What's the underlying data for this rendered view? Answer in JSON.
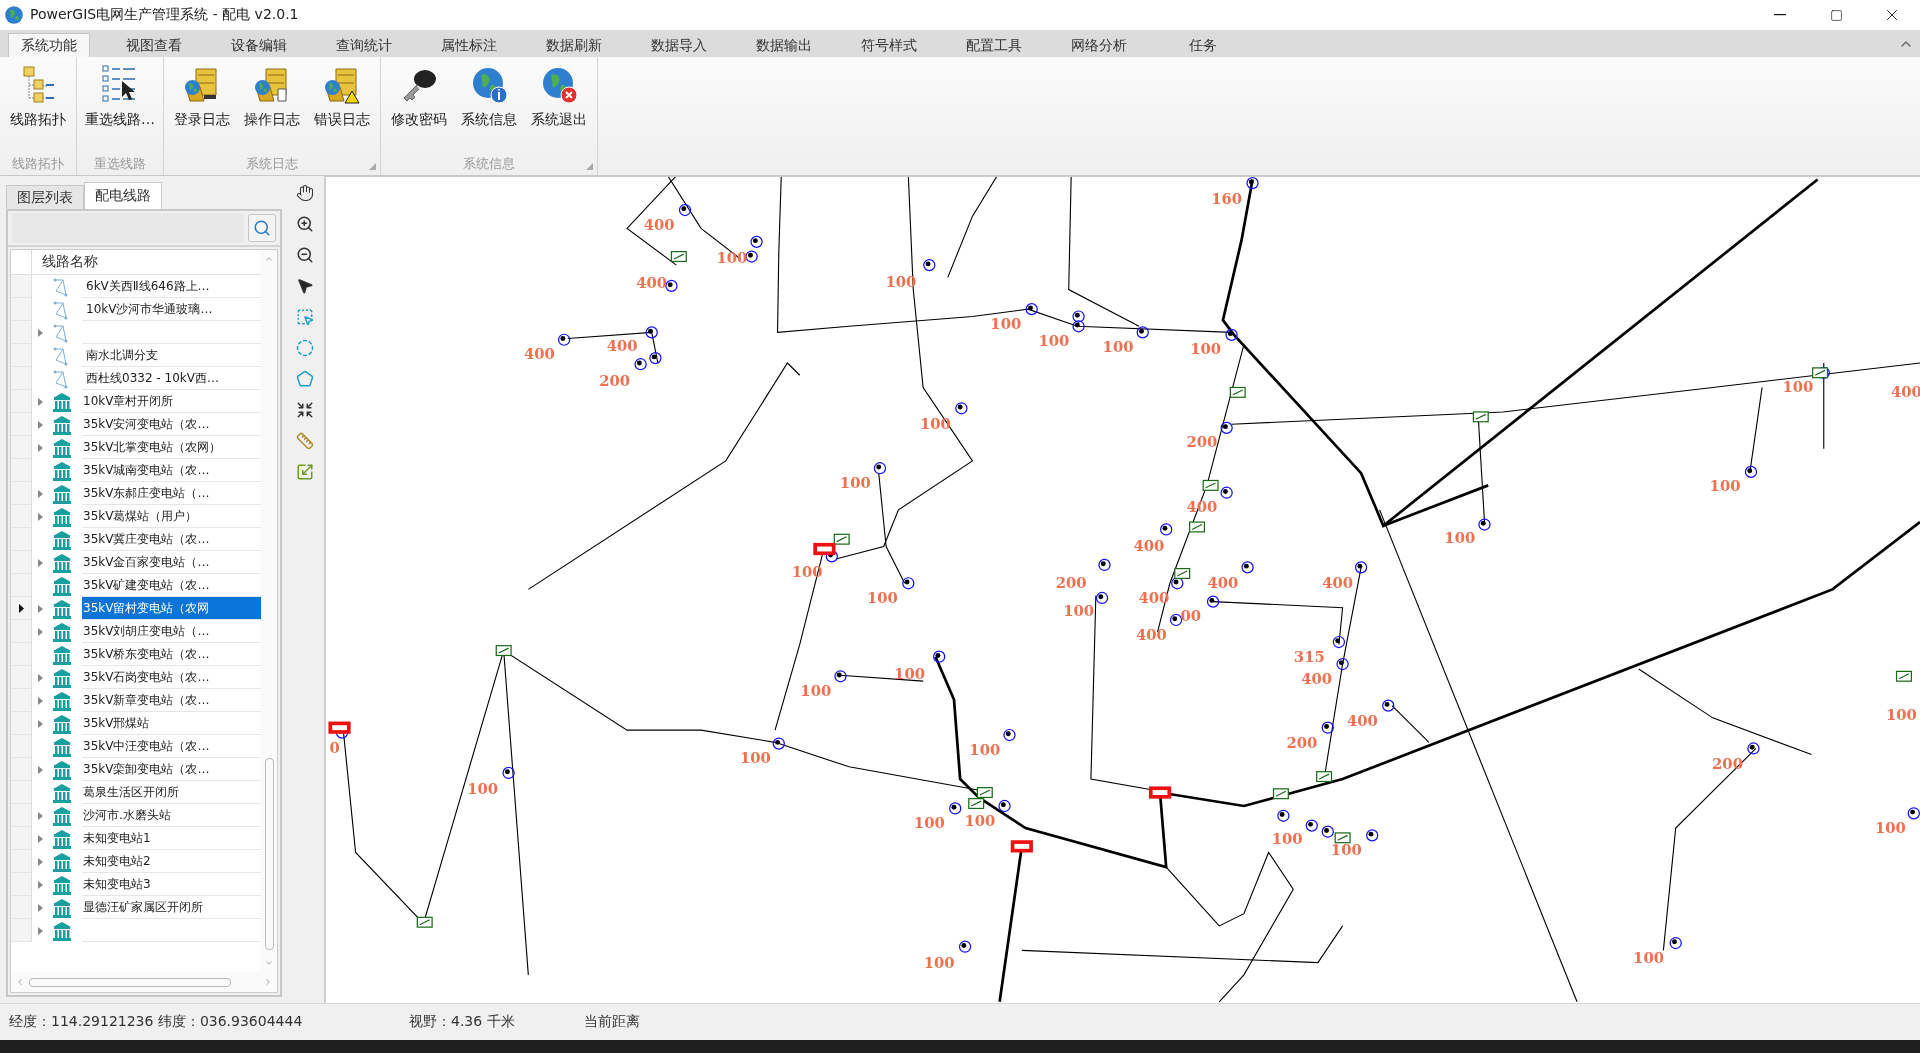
{
  "window": {
    "title": "PowerGIS电网生产管理系统 - 配电 v2.0.1"
  },
  "ribbon_tabs": [
    {
      "label": "系统功能",
      "selected": true
    },
    {
      "label": "视图查看",
      "selected": false
    },
    {
      "label": "设备编辑",
      "selected": false
    },
    {
      "label": "查询统计",
      "selected": false
    },
    {
      "label": "属性标注",
      "selected": false
    },
    {
      "label": "数据刷新",
      "selected": false
    },
    {
      "label": "数据导入",
      "selected": false
    },
    {
      "label": "数据输出",
      "selected": false
    },
    {
      "label": "符号样式",
      "selected": false
    },
    {
      "label": "配置工具",
      "selected": false
    },
    {
      "label": "网络分析",
      "selected": false
    },
    {
      "label": "任务",
      "selected": false
    }
  ],
  "ribbon_groups": [
    {
      "title": "线路拓扑",
      "launcher": false,
      "buttons": [
        {
          "label": "线路拓扑",
          "kind": "topology"
        }
      ]
    },
    {
      "title": "重选线路",
      "launcher": false,
      "buttons": [
        {
          "label": "重选线路…",
          "kind": "reselect"
        }
      ]
    },
    {
      "title": "系统日志",
      "launcher": true,
      "buttons": [
        {
          "label": "登录日志",
          "kind": "log-login"
        },
        {
          "label": "操作日志",
          "kind": "log-operation"
        },
        {
          "label": "错误日志",
          "kind": "log-error"
        }
      ]
    },
    {
      "title": "系统信息",
      "launcher": true,
      "buttons": [
        {
          "label": "修改密码",
          "kind": "key"
        },
        {
          "label": "系统信息",
          "kind": "globe-info"
        },
        {
          "label": "系统退出",
          "kind": "globe-exit"
        }
      ]
    }
  ],
  "left_panel": {
    "tabs": [
      {
        "label": "图层列表",
        "selected": false
      },
      {
        "label": "配电线路",
        "selected": true
      }
    ],
    "column": "线路名称",
    "rows": [
      {
        "kind": "line",
        "label": "6kV关西Ⅱ线646路上…",
        "has_children": false,
        "selected": false
      },
      {
        "kind": "line",
        "label": "10kV沙河市华通玻璃…",
        "has_children": false,
        "selected": false
      },
      {
        "kind": "line",
        "has_children": true,
        "selected": false
      },
      {
        "kind": "line",
        "label": "南水北调分支",
        "has_children": false,
        "selected": false
      },
      {
        "kind": "line",
        "label": "西杜线0332 - 10kV西…",
        "has_children": false,
        "selected": false
      },
      {
        "kind": "station",
        "label": "10kV章村开闭所",
        "has_children": true,
        "selected": false
      },
      {
        "kind": "station",
        "label": "35kV安河变电站（农…",
        "has_children": true,
        "selected": false
      },
      {
        "kind": "station",
        "label": "35kV北掌变电站（农网）",
        "has_children": true,
        "selected": false
      },
      {
        "kind": "station",
        "label": "35kV城南变电站（农…",
        "has_children": false,
        "selected": false
      },
      {
        "kind": "station",
        "label": "35kV东郝庄变电站（…",
        "has_children": true,
        "selected": false
      },
      {
        "kind": "station",
        "label": "35kV葛煤站（用户）",
        "has_children": true,
        "selected": false
      },
      {
        "kind": "station",
        "label": "35kV冀庄变电站（农…",
        "has_children": false,
        "selected": false
      },
      {
        "kind": "station",
        "label": "35kV金百家变电站（…",
        "has_children": true,
        "selected": false
      },
      {
        "kind": "station",
        "label": "35kV矿建变电站（农…",
        "has_children": false,
        "selected": false
      },
      {
        "kind": "station",
        "label": "35kV留村变电站（农网",
        "has_children": true,
        "selected": true
      },
      {
        "kind": "station",
        "label": "35kV刘胡庄变电站（…",
        "has_children": true,
        "selected": false
      },
      {
        "kind": "station",
        "label": "35kV桥东变电站（农…",
        "has_children": false,
        "selected": false
      },
      {
        "kind": "station",
        "label": "35kV石岗变电站（农…",
        "has_children": true,
        "selected": false
      },
      {
        "kind": "station",
        "label": "35kV新章变电站（农…",
        "has_children": true,
        "selected": false
      },
      {
        "kind": "station",
        "label": "35kV邢煤站",
        "has_children": true,
        "selected": false
      },
      {
        "kind": "station",
        "label": "35kV中汪变电站（农…",
        "has_children": false,
        "selected": false
      },
      {
        "kind": "station",
        "label": "35kV栾卸变电站（农…",
        "has_children": true,
        "selected": false
      },
      {
        "kind": "station",
        "label": "葛泉生活区开闭所",
        "has_children": false,
        "selected": false
      },
      {
        "kind": "station",
        "label": "沙河市.水磨头站",
        "has_children": true,
        "selected": false
      },
      {
        "kind": "station",
        "label": "未知变电站1",
        "has_children": true,
        "selected": false
      },
      {
        "kind": "station",
        "label": "未知变电站2",
        "has_children": true,
        "selected": false
      },
      {
        "kind": "station",
        "label": "未知变电站3",
        "has_children": true,
        "selected": false
      },
      {
        "kind": "station",
        "label": "显德汪矿家属区开闭所",
        "has_children": true,
        "selected": false
      },
      {
        "kind": "station",
        "has_children": true,
        "selected": false
      }
    ]
  },
  "map": {
    "labels": [
      "400",
      "100",
      "400",
      "100",
      "400",
      "400",
      "200",
      "160",
      "100",
      "100",
      "100",
      "100",
      "100",
      "200",
      "100",
      "400",
      "100",
      "100",
      "400",
      "100",
      "400",
      "100",
      "100",
      "200",
      "100",
      "400",
      "400",
      "400",
      "400",
      "00",
      "315",
      "400",
      "100",
      "100",
      "400",
      "200",
      "100",
      "100",
      "100",
      "0",
      "200",
      "100",
      "100",
      "100",
      "100",
      "100",
      "100",
      "100",
      "100"
    ]
  },
  "status_bar": {
    "coordinates": "经度：114.29121236 纬度：036.93604444",
    "view": "视野：4.36 千米",
    "distance": "当前距离"
  }
}
